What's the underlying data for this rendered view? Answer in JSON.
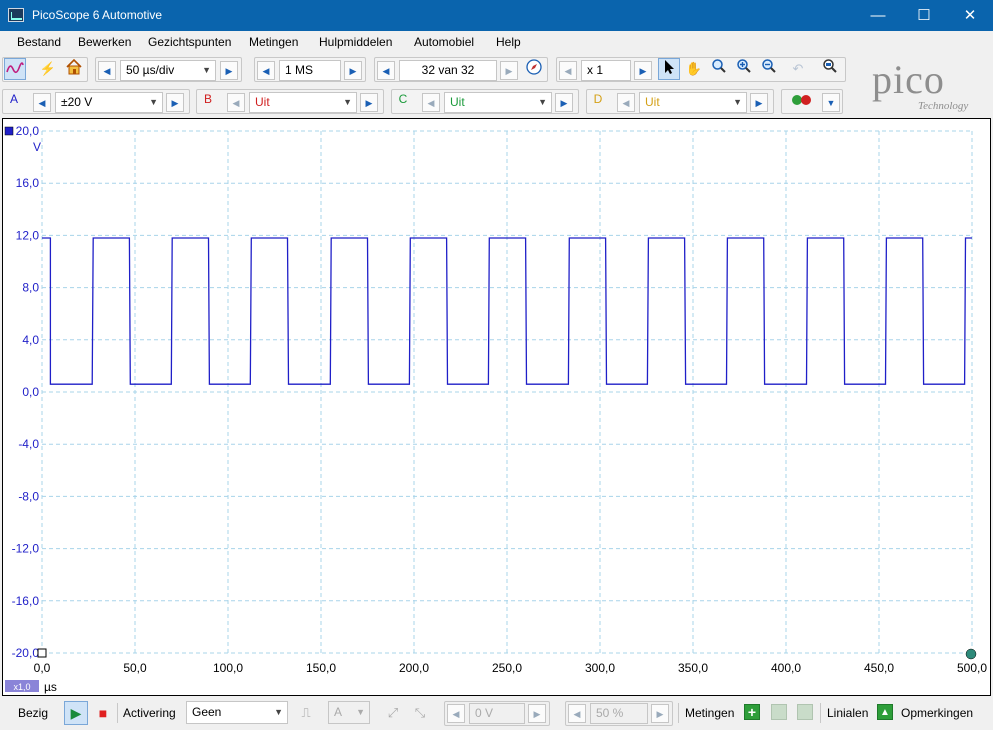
{
  "window": {
    "title": "PicoScope 6 Automotive",
    "minimize": "—",
    "maximize": "☐",
    "close": "✕"
  },
  "menu": [
    "Bestand",
    "Bewerken",
    "Gezichtspunten",
    "Metingen",
    "Hulpmiddelen",
    "Automobiel",
    "Help"
  ],
  "toolbar1": {
    "timebase": "50 µs/div",
    "samples": "1 MS",
    "buffer": "32 van 32",
    "zoom": "x 1"
  },
  "channels": [
    {
      "letter": "A",
      "range": "±20 V",
      "color": "#1f1fc8"
    },
    {
      "letter": "B",
      "range": "Uit",
      "color": "#d02020"
    },
    {
      "letter": "C",
      "range": "Uit",
      "color": "#1a9a3a"
    },
    {
      "letter": "D",
      "range": "Uit",
      "color": "#d4a017"
    }
  ],
  "logo": {
    "word": "pico",
    "tag": "Technology"
  },
  "scope": {
    "y_unit": "V",
    "x_unit": "µs",
    "zoom_badge": "x1,0",
    "trace_color": "#1f1fc8"
  },
  "chart_data": {
    "type": "line",
    "ylim": [
      -20,
      20
    ],
    "xlim": [
      0,
      500
    ],
    "yticks": [
      "20,0",
      "16,0",
      "12,0",
      "8,0",
      "4,0",
      "0,0",
      "-4,0",
      "-8,0",
      "-12,0",
      "-16,0",
      "-20,0"
    ],
    "xticks": [
      "0,0",
      "50,0",
      "100,0",
      "150,0",
      "200,0",
      "250,0",
      "300,0",
      "350,0",
      "400,0",
      "450,0",
      "500,0"
    ],
    "grid": true,
    "series": [
      {
        "high": 11.8,
        "low": 0.6,
        "transitions": [
          [
            0,
            11.8
          ],
          [
            4.5,
            11.8
          ],
          [
            4.5,
            0.6
          ],
          [
            27,
            0.6
          ],
          [
            27.5,
            11.8
          ],
          [
            47,
            11.8
          ],
          [
            47.5,
            0.6
          ],
          [
            69.5,
            0.6
          ],
          [
            70,
            11.8
          ],
          [
            89.5,
            11.8
          ],
          [
            90,
            0.6
          ],
          [
            112,
            0.6
          ],
          [
            112.5,
            11.8
          ],
          [
            132,
            11.8
          ],
          [
            132.5,
            0.6
          ],
          [
            155,
            0.6
          ],
          [
            155.5,
            11.8
          ],
          [
            175,
            11.8
          ],
          [
            175.5,
            0.6
          ],
          [
            197.5,
            0.6
          ],
          [
            198,
            11.8
          ],
          [
            217.5,
            11.8
          ],
          [
            218,
            0.6
          ],
          [
            240,
            0.6
          ],
          [
            240.5,
            11.8
          ],
          [
            260,
            11.8
          ],
          [
            260.5,
            0.6
          ],
          [
            283,
            0.6
          ],
          [
            283.5,
            11.8
          ],
          [
            303,
            11.8
          ],
          [
            303.5,
            0.6
          ],
          [
            325.5,
            0.6
          ],
          [
            326,
            11.8
          ],
          [
            345.5,
            11.8
          ],
          [
            346,
            0.6
          ],
          [
            368,
            0.6
          ],
          [
            368.5,
            11.8
          ],
          [
            388,
            11.8
          ],
          [
            388.5,
            0.6
          ],
          [
            411,
            0.6
          ],
          [
            411.5,
            11.8
          ],
          [
            431,
            11.8
          ],
          [
            431.5,
            0.6
          ],
          [
            453.5,
            0.6
          ],
          [
            454,
            11.8
          ],
          [
            473.5,
            11.8
          ],
          [
            474,
            0.6
          ],
          [
            496,
            0.6
          ],
          [
            496.5,
            11.8
          ],
          [
            500,
            11.8
          ]
        ]
      }
    ]
  },
  "statusbar": {
    "state": "Bezig",
    "trigger_label": "Activering",
    "trigger_mode": "Geen",
    "trigger_channel": "A",
    "trigger_level": "0 V",
    "trigger_pos": "50 %",
    "measurements": "Metingen",
    "rulers": "Linialen",
    "notes": "Opmerkingen"
  }
}
